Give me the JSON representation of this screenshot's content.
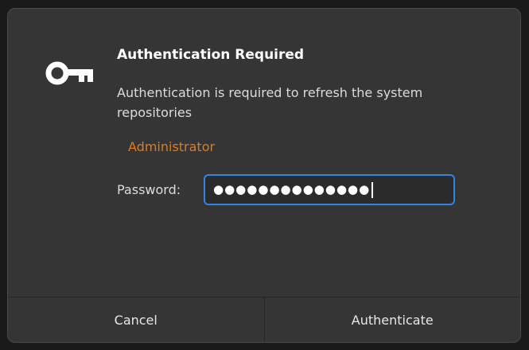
{
  "dialog": {
    "icon": "key-icon",
    "title": "Authentication Required",
    "message": "Authentication is required to refresh the system repositories",
    "user": "Administrator",
    "password_label": "Password:",
    "password_masked": "●●●●●●●●●●●●●●",
    "cancel_label": "Cancel",
    "authenticate_label": "Authenticate"
  },
  "colors": {
    "background": "#353535",
    "accent": "#3584e4",
    "user_name": "#e07b1a"
  }
}
